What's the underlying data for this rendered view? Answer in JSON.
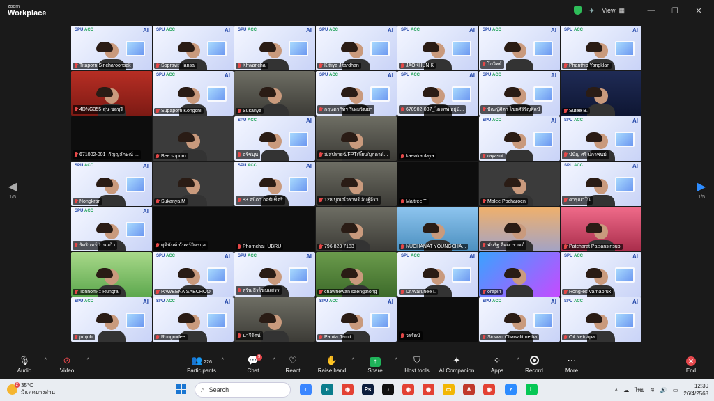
{
  "window": {
    "brand_top": "zoom",
    "brand_bottom": "Workplace",
    "view_label": "View"
  },
  "pager": {
    "left": "1/5",
    "right": "1/5"
  },
  "participants": [
    {
      "name": "Titaporn Sincharoonsak",
      "bg": "spu"
    },
    {
      "name": "Sopravit Hansai",
      "bg": "spu"
    },
    {
      "name": "Khwanchai",
      "bg": "spu"
    },
    {
      "name": "Kittiya Jitardhan",
      "bg": "spu"
    },
    {
      "name": "JAOKHUN K",
      "bg": "spu"
    },
    {
      "name": "โกวิทย์",
      "bg": "spu"
    },
    {
      "name": "Phanthip Yangklan",
      "bg": "spu"
    },
    {
      "name": "4DNG355-สุน-ชลบุรี",
      "bg": "red"
    },
    {
      "name": "Supaporn Kongchi",
      "bg": "spu"
    },
    {
      "name": "Sukanya",
      "bg": "room"
    },
    {
      "name": "กฤษดากัทร รีเหยวิฒยา",
      "bg": "spu"
    },
    {
      "name": "670902-087_ไตรภพ อยู่นิ...",
      "bg": "spu"
    },
    {
      "name": "ปัณญ์ศิตา ไชยศิริรัญศิลป์",
      "bg": "spu"
    },
    {
      "name": "Sutee B.",
      "bg": "navy"
    },
    {
      "name": "671002-001_กัญญลักษณ์ ...",
      "bg": "dark"
    },
    {
      "name": "Bee suporn",
      "bg": "gray"
    },
    {
      "name": "อรัชนุน",
      "bg": "spu"
    },
    {
      "name": "ส/สุปรายฉ์/FPTเจี๊ยบ/มุกดาห์...",
      "bg": "room"
    },
    {
      "name": "kaewkanlaya",
      "bg": "dark"
    },
    {
      "name": "rayasut",
      "bg": "spu"
    },
    {
      "name": "ปนัญ ศรี ปกาพนม์",
      "bg": "spu"
    },
    {
      "name": "Nongkran",
      "bg": "spu"
    },
    {
      "name": "Sukanya.M",
      "bg": "gray"
    },
    {
      "name": "83 จนิดา กอซิเซ็ตรี",
      "bg": "spu"
    },
    {
      "name": "128 บุณณ์วราทร์ ลินฐ์จีรา",
      "bg": "room"
    },
    {
      "name": "Maitree.T",
      "bg": "dark"
    },
    {
      "name": "Malee Pocharoen",
      "bg": "gray"
    },
    {
      "name": "ดารุณาใน",
      "bg": "spu"
    },
    {
      "name": "รัตรินทร์ปานแก้ว",
      "bg": "spu"
    },
    {
      "name": "ศุศินันท์ นันทร์จิตรกุล",
      "bg": "dark"
    },
    {
      "name": "Phornchai_UBRU",
      "bg": "dark"
    },
    {
      "name": "796 823 7183",
      "bg": "room"
    },
    {
      "name": "NUCHANAT YOUNGCHA...",
      "bg": "sky"
    },
    {
      "name": "พันรัฐ ลี้ตดาราคม์",
      "bg": "sunset"
    },
    {
      "name": "Patcharat Paisansinsup",
      "bg": "pink"
    },
    {
      "name": "Tonhom-:: Rungfa",
      "bg": "green"
    },
    {
      "name": "PAWEENA SAECHOO",
      "bg": "spu"
    },
    {
      "name": "สุรัน ธีรโฆมแสรร",
      "bg": "spu"
    },
    {
      "name": "chawhewan saengthong",
      "bg": "garden"
    },
    {
      "name": "Dr.Warunee I.",
      "bg": "spu"
    },
    {
      "name": "orapin",
      "bg": "neon"
    },
    {
      "name": "Rong-ek Varnaprux",
      "bg": "spu"
    },
    {
      "name": "jubjub",
      "bg": "spu"
    },
    {
      "name": "Rungrudee",
      "bg": "spu"
    },
    {
      "name": "นารีรัตน์",
      "bg": "room"
    },
    {
      "name": "Panita Jamit",
      "bg": "spu"
    },
    {
      "name": "วรรัตน์",
      "bg": "dark"
    },
    {
      "name": "Siriwan Chawalitmetha",
      "bg": "spu"
    },
    {
      "name": "Oil Netnapa",
      "bg": "spu"
    }
  ],
  "tile_logo": {
    "spu": "SPU",
    "acc": "ACC",
    "ai": "AI"
  },
  "toolbar": {
    "audio": "Audio",
    "video": "Video",
    "participants": "Participants",
    "participant_count": "226",
    "chat": "Chat",
    "chat_badge": "9",
    "react": "React",
    "raise_hand": "Raise hand",
    "share": "Share",
    "host_tools": "Host tools",
    "ai_companion": "AI Companion",
    "apps": "Apps",
    "record": "Record",
    "more": "More",
    "end": "End"
  },
  "taskbar": {
    "temp": "35°C",
    "weather_desc": "มีแดดบางส่วน",
    "weather_badge": "2",
    "search_placeholder": "Search",
    "lang": "ไทย",
    "time": "12:30",
    "date": "26/4/2568"
  },
  "colors": {
    "accent": "#2d8cff",
    "share_green": "#1fb35a",
    "end_red": "#e5484d"
  }
}
